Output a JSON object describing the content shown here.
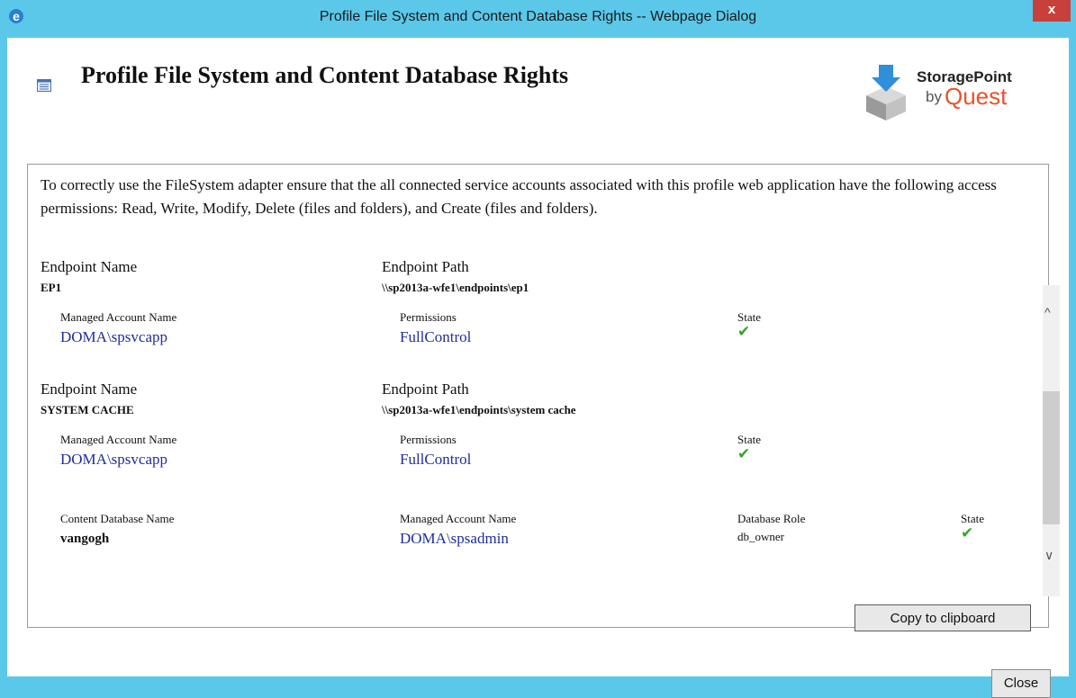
{
  "window": {
    "title": "Profile File System and Content Database Rights -- Webpage Dialog",
    "close_glyph": "x"
  },
  "header": {
    "title": "Profile File System and Content Database Rights",
    "logo_line1": "StoragePoint",
    "logo_by": "by",
    "logo_brand": "Quest"
  },
  "intro": "To correctly use the FileSystem adapter ensure that the all connected service accounts associated with this profile web application have the following access permissions: Read, Write, Modify, Delete (files and folders), and Create (files and folders).",
  "endpoints": [
    {
      "name_label": "Endpoint Name",
      "name": "EP1",
      "path_label": "Endpoint Path",
      "path": "\\\\sp2013a-wfe1\\endpoints\\ep1",
      "account_label": "Managed Account Name",
      "account": "DOMA\\spsvcapp",
      "perm_label": "Permissions",
      "permission": "FullControl",
      "state_label": "State"
    },
    {
      "name_label": "Endpoint Name",
      "name": "SYSTEM CACHE",
      "path_label": "Endpoint Path",
      "path": "\\\\sp2013a-wfe1\\endpoints\\system cache",
      "account_label": "Managed Account Name",
      "account": "DOMA\\spsvcapp",
      "perm_label": "Permissions",
      "permission": "FullControl",
      "state_label": "State"
    }
  ],
  "content_db": {
    "db_label": "Content Database Name",
    "db_name": "vangogh",
    "account_label": "Managed Account Name",
    "account": "DOMA\\spsadmin",
    "role_label": "Database Role",
    "role": "db_owner",
    "state_label": "State"
  },
  "state_ok_glyph": "✔",
  "buttons": {
    "copy": "Copy to clipboard",
    "close": "Close"
  },
  "scrollbar": {
    "up": "^",
    "down": "∨"
  },
  "colors": {
    "accent": "#5bc8ea",
    "link": "#1f2f9c",
    "ok": "#3aa02b",
    "brand": "#e8532c"
  }
}
